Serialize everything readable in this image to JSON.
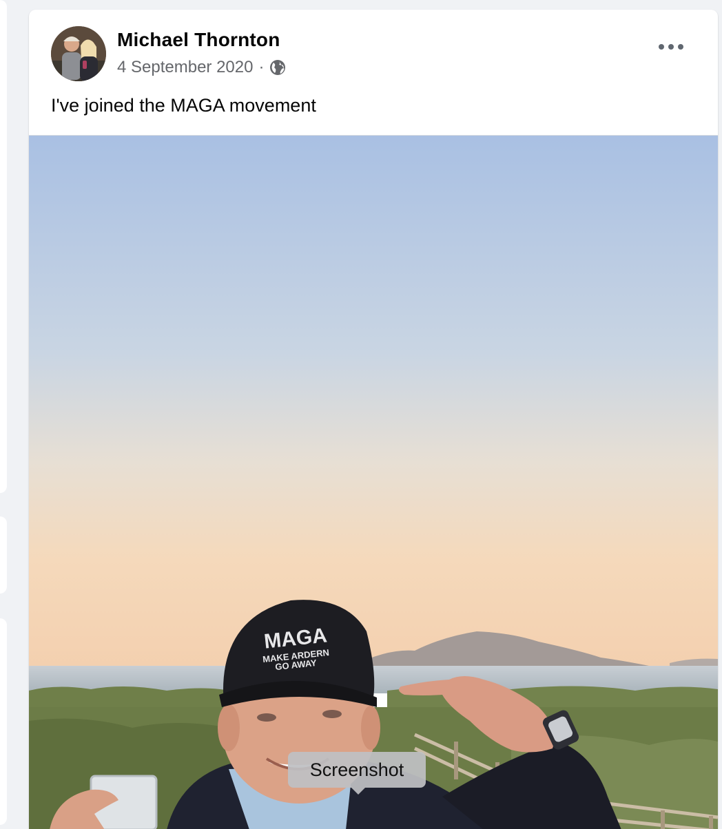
{
  "post": {
    "author": "Michael Thornton",
    "date": "4 September 2020",
    "separator": "·",
    "privacy_icon": "globe-icon",
    "text": "I've joined the MAGA movement",
    "options_icon": "more-options-icon"
  },
  "photo": {
    "cap_line1": "MAGA",
    "cap_line2": "MAKE ARDERN",
    "cap_line3": "GO AWAY"
  },
  "tooltip": {
    "label": "Screenshot"
  },
  "colors": {
    "text_primary": "#050505",
    "text_secondary": "#65676b",
    "background": "#f0f2f5"
  }
}
